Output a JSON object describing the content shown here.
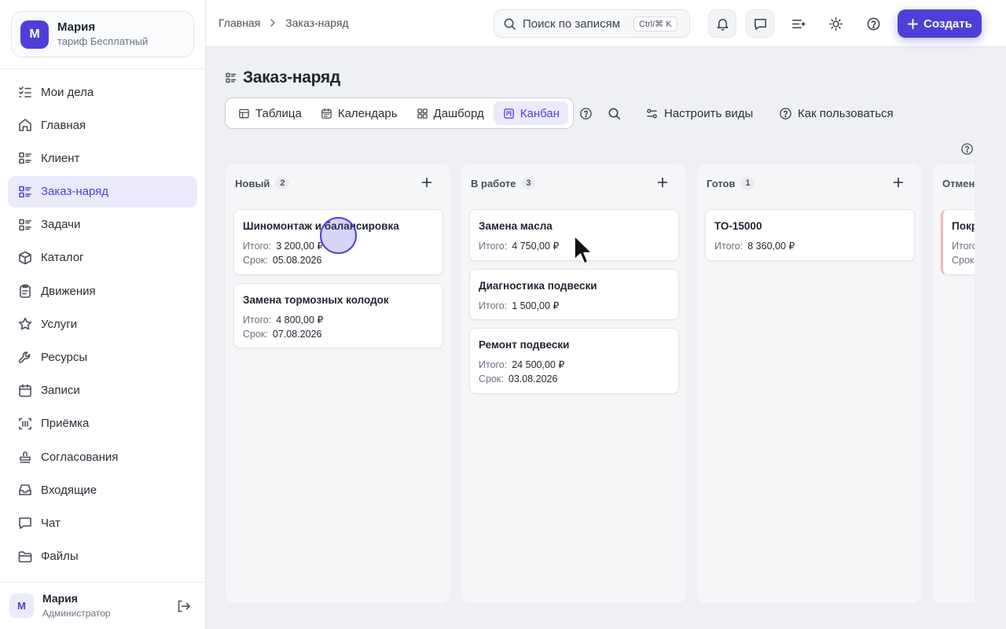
{
  "org": {
    "avatar": "М",
    "name": "Мария",
    "plan": "тариф Бесплатный"
  },
  "sidebar": {
    "items": [
      {
        "label": "Мои дела",
        "icon": "checklist-icon"
      },
      {
        "label": "Главная",
        "icon": "home-icon"
      },
      {
        "label": "Клиент",
        "icon": "list-icon"
      },
      {
        "label": "Заказ-наряд",
        "icon": "list-icon",
        "active": true
      },
      {
        "label": "Задачи",
        "icon": "list-icon"
      },
      {
        "label": "Каталог",
        "icon": "box-icon"
      },
      {
        "label": "Движения",
        "icon": "clipboard-icon"
      },
      {
        "label": "Услуги",
        "icon": "star-icon"
      },
      {
        "label": "Ресурсы",
        "icon": "wrench-icon"
      },
      {
        "label": "Записи",
        "icon": "calendar-icon"
      },
      {
        "label": "Приёмка",
        "icon": "barcode-scan-icon"
      },
      {
        "label": "Согласования",
        "icon": "stamp-icon"
      },
      {
        "label": "Входящие",
        "icon": "inbox-icon"
      },
      {
        "label": "Чат",
        "icon": "chat-icon"
      },
      {
        "label": "Файлы",
        "icon": "folder-icon"
      }
    ]
  },
  "user": {
    "avatar": "М",
    "name": "Мария",
    "role": "Администратор"
  },
  "breadcrumb": {
    "home": "Главная",
    "current": "Заказ-наряд"
  },
  "search": {
    "placeholder": "Поиск по записям",
    "shortcut": "Ctrl/⌘ K"
  },
  "header": {
    "create_label": "Создать"
  },
  "page": {
    "title": "Заказ-наряд"
  },
  "views": {
    "tabs": [
      {
        "label": "Таблица",
        "icon": "table-icon"
      },
      {
        "label": "Календарь",
        "icon": "calendar-icon"
      },
      {
        "label": "Дашборд",
        "icon": "dashboard-icon"
      },
      {
        "label": "Канбан",
        "icon": "kanban-icon",
        "active": true
      }
    ],
    "configure_label": "Настроить виды",
    "howto_label": "Как пользоваться"
  },
  "colors": {
    "accent": "#4f3fd8",
    "accent_soft": "#ebeafb",
    "page_bg": "#eef0f4"
  },
  "board": {
    "columns": [
      {
        "title": "Новый",
        "count": "2",
        "cards": [
          {
            "title": "Шиномонтаж и балансировка",
            "total_label": "Итого:",
            "total": "3 200,00 ₽",
            "due_label": "Срок:",
            "due": "05.08.2026"
          },
          {
            "title": "Замена тормозных колодок",
            "total_label": "Итого:",
            "total": "4 800,00 ₽",
            "due_label": "Срок:",
            "due": "07.08.2026"
          }
        ]
      },
      {
        "title": "В работе",
        "count": "3",
        "cards": [
          {
            "title": "Замена масла",
            "total_label": "Итого:",
            "total": "4 750,00 ₽"
          },
          {
            "title": "Диагностика подвески",
            "total_label": "Итого:",
            "total": "1 500,00 ₽"
          },
          {
            "title": "Ремонт подвески",
            "total_label": "Итого:",
            "total": "24 500,00 ₽",
            "due_label": "Срок:",
            "due": "03.08.2026"
          }
        ]
      },
      {
        "title": "Готов",
        "count": "1",
        "cards": [
          {
            "title": "ТО-15000",
            "total_label": "Итого:",
            "total": "8 360,00 ₽"
          }
        ]
      },
      {
        "title": "Отмен",
        "cards": [
          {
            "title": "Покр",
            "total_label": "Итого",
            "due_label": "Срок:"
          }
        ]
      }
    ]
  }
}
